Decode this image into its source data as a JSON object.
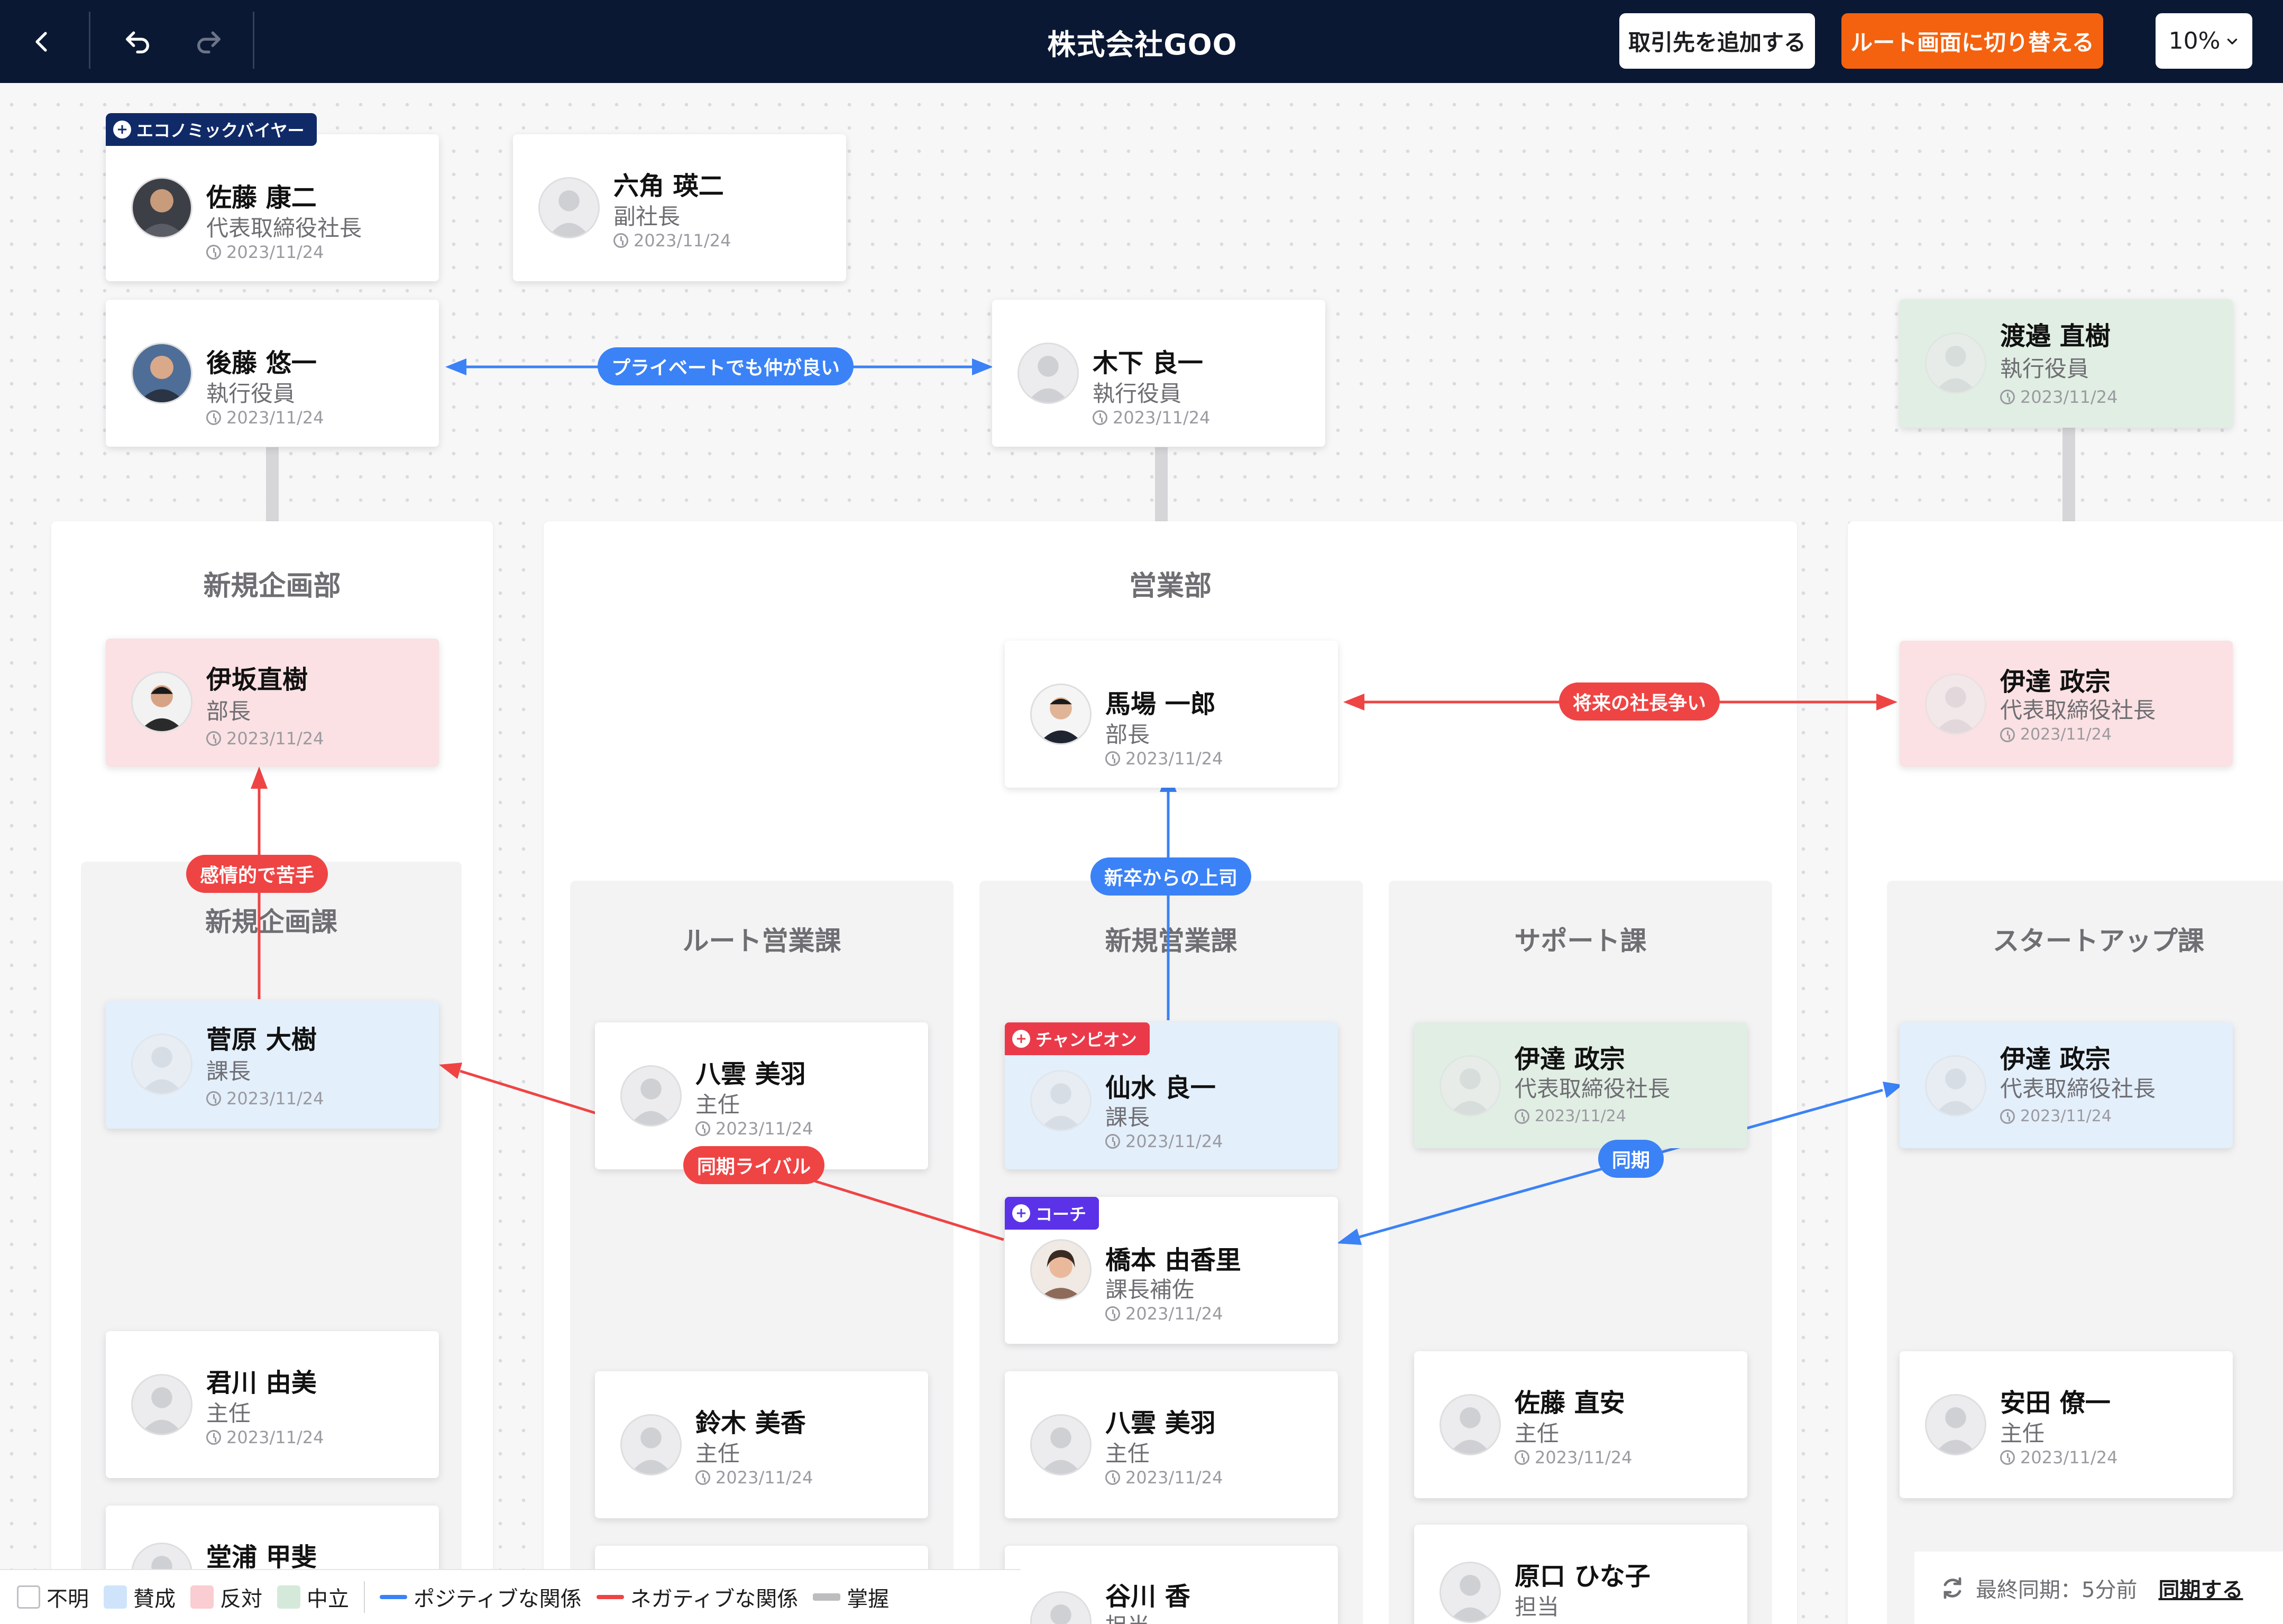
{
  "header": {
    "title": "株式会社GOO",
    "add_client": "取引先を追加する",
    "switch_view": "ルート画面に切り替える",
    "zoom": "10%"
  },
  "departments": {
    "new_planning": "新規企画部",
    "sales": "営業部"
  },
  "sections": {
    "new_planning_sec": "新規企画課",
    "route_sales": "ルート営業課",
    "new_sales": "新規営業課",
    "support": "サポート課",
    "startup": "スタートアップ課"
  },
  "people": {
    "sato_koji": {
      "name": "佐藤 康二",
      "role": "代表取締役社長",
      "date": "2023/11/24",
      "tag": "エコノミックバイヤー"
    },
    "rokkaku": {
      "name": "六角 瑛二",
      "role": "副社長",
      "date": "2023/11/24"
    },
    "goto": {
      "name": "後藤 悠一",
      "role": "執行役員",
      "date": "2023/11/24"
    },
    "kinoshita": {
      "name": "木下 良一",
      "role": "執行役員",
      "date": "2023/11/24"
    },
    "watanabe": {
      "name": "渡邉 直樹",
      "role": "執行役員",
      "date": "2023/11/24"
    },
    "isaka": {
      "name": "伊坂直樹",
      "role": "部長",
      "date": "2023/11/24"
    },
    "baba": {
      "name": "馬場 一郎",
      "role": "部長",
      "date": "2023/11/24"
    },
    "date_top": {
      "name": "伊達 政宗",
      "role": "代表取締役社長",
      "date": "2023/11/24"
    },
    "sugawara": {
      "name": "菅原 大樹",
      "role": "課長",
      "date": "2023/11/24"
    },
    "yakumo1": {
      "name": "八雲 美羽",
      "role": "主任",
      "date": "2023/11/24"
    },
    "sensui": {
      "name": "仙水 良一",
      "role": "課長",
      "date": "2023/11/24",
      "tag": "チャンピオン"
    },
    "date_sup": {
      "name": "伊達 政宗",
      "role": "代表取締役社長",
      "date": "2023/11/24"
    },
    "date_start": {
      "name": "伊達 政宗",
      "role": "代表取締役社長",
      "date": "2023/11/24"
    },
    "hashimoto": {
      "name": "橋本 由香里",
      "role": "課長補佐",
      "date": "2023/11/24",
      "tag": "コーチ"
    },
    "kimikawa": {
      "name": "君川 由美",
      "role": "主任",
      "date": "2023/11/24"
    },
    "suzuki": {
      "name": "鈴木 美香",
      "role": "主任",
      "date": "2023/11/24"
    },
    "yakumo2": {
      "name": "八雲 美羽",
      "role": "主任",
      "date": "2023/11/24"
    },
    "sato_naoyasu": {
      "name": "佐藤 直安",
      "role": "主任",
      "date": "2023/11/24"
    },
    "yasuda": {
      "name": "安田 僚一",
      "role": "主任",
      "date": "2023/11/24"
    },
    "douura": {
      "name": "堂浦 甲斐",
      "role": "",
      "date": ""
    },
    "tanigawa": {
      "name": "谷川 香",
      "role": "担当",
      "date": ""
    },
    "haraguchi": {
      "name": "原口 ひな子",
      "role": "担当",
      "date": ""
    }
  },
  "relations": {
    "private": "プライベートでも仲が良い",
    "rival_future": "将来の社長争い",
    "emotional": "感情的で苦手",
    "boss": "新卒からの上司",
    "rival_same": "同期ライバル",
    "same_year": "同期"
  },
  "legend": {
    "unknown": "不明",
    "pro": "賛成",
    "con": "反対",
    "neutral": "中立",
    "positive": "ポジティブな関係",
    "negative": "ネガティブな関係",
    "grasp": "掌握"
  },
  "colors": {
    "positive": "#3b82f6",
    "negative": "#ef4444",
    "pro": "#e3effb",
    "con": "#fbe1e3",
    "neutral": "#e1eee4",
    "brand": "#0b1833",
    "accent": "#f4620f"
  },
  "sync": {
    "last": "最終同期：5分前",
    "action": "同期する"
  }
}
